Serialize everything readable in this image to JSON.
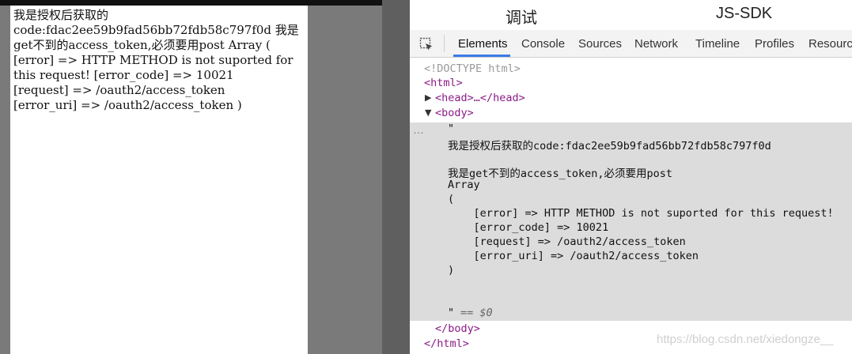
{
  "page": {
    "lines": [
      "我是授权后获取的",
      "code:fdac2ee59b9fad56bb72fdb58c797f0d 我是",
      "get不到的access_token,必须要用post Array (",
      "[error] => HTTP METHOD is not suported for",
      "this request! [error_code] => 10021",
      "[request] => /oauth2/access_token",
      "[error_uri] => /oauth2/access_token )"
    ]
  },
  "devtools": {
    "title_left": "调试",
    "title_right": "JS-SDK",
    "tabs": [
      "Elements",
      "Console",
      "Sources",
      "Network",
      "Timeline",
      "Profiles",
      "Resource"
    ],
    "active_tab": "Elements",
    "elements": {
      "doctype": "<!DOCTYPE html>",
      "html_open": "<html>",
      "head_collapsed": "<head>…</head>",
      "body_open": "<body>",
      "quote_open": "\"",
      "text_lines": [
        "我是授权后获取的code:fdac2ee59b9fad56bb72fdb58c797f0d",
        "",
        "我是get不到的access_token,必须要用post",
        "Array",
        "(",
        "    [error] => HTTP METHOD is not suported for this request!",
        "    [error_code] => 10021",
        "    [request] => /oauth2/access_token",
        "    [error_uri] => /oauth2/access_token",
        ")"
      ],
      "quote_close": "\"",
      "dollar_ref": "== $0",
      "body_close": "</body>",
      "html_close": "</html>"
    },
    "dots": "…"
  },
  "watermark": "https://blog.csdn.net/xiedongze__",
  "colors": {
    "tag": "#8a1a88",
    "doctype": "#9a9a9a",
    "selected_bg": "#dcdcdc",
    "active_tab_underline": "#3b7be8"
  },
  "icons": [
    "inspect-element-icon",
    "expand-triangle-icon",
    "collapse-triangle-icon",
    "more-dots-icon"
  ]
}
